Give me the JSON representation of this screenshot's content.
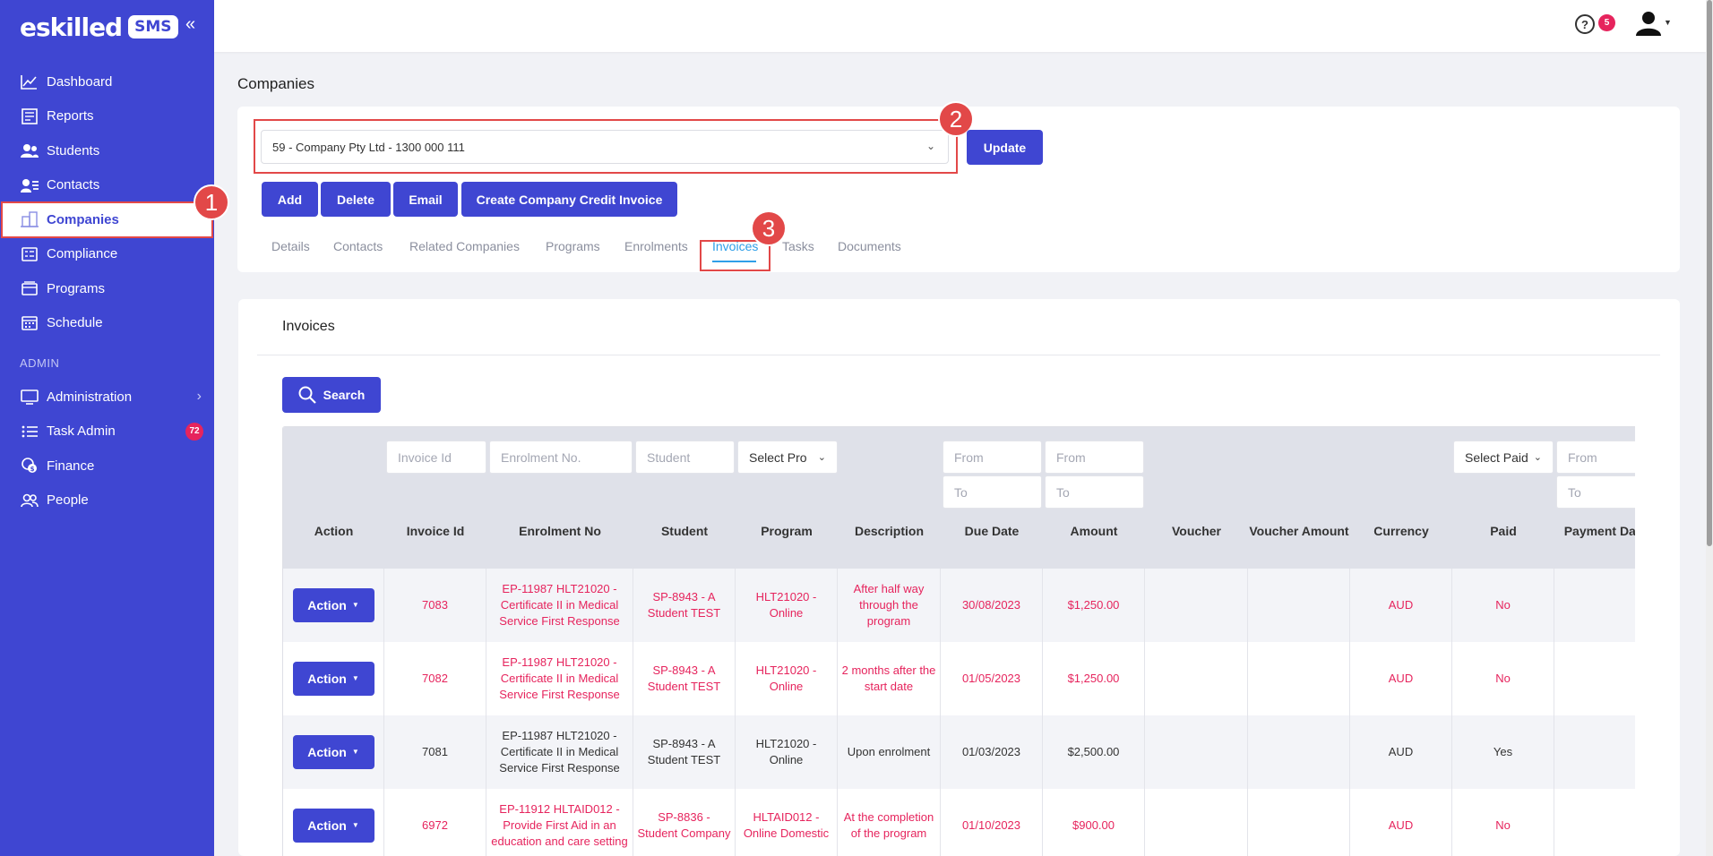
{
  "brand": {
    "logo_text": "eskilled",
    "badge": "SMS"
  },
  "sidebar": {
    "items": [
      {
        "label": "Dashboard",
        "icon": "chart-line-icon"
      },
      {
        "label": "Reports",
        "icon": "report-icon"
      },
      {
        "label": "Students",
        "icon": "students-icon"
      },
      {
        "label": "Contacts",
        "icon": "contacts-icon"
      },
      {
        "label": "Companies",
        "icon": "building-icon",
        "active": true
      },
      {
        "label": "Compliance",
        "icon": "checklist-icon"
      },
      {
        "label": "Programs",
        "icon": "programs-icon"
      },
      {
        "label": "Schedule",
        "icon": "calendar-icon"
      }
    ],
    "section_label": "ADMIN",
    "admin_items": [
      {
        "label": "Administration",
        "icon": "monitor-icon"
      },
      {
        "label": "Task Admin",
        "icon": "list-icon",
        "badge": "72"
      },
      {
        "label": "Finance",
        "icon": "coins-icon"
      },
      {
        "label": "People",
        "icon": "people-icon"
      }
    ]
  },
  "topbar": {
    "help_icon": "?",
    "notification_count": "5"
  },
  "page": {
    "title": "Companies"
  },
  "company": {
    "selected": "59 - Company Pty Ltd - 1300 000 111",
    "update_label": "Update",
    "buttons": {
      "add": "Add",
      "delete": "Delete",
      "email": "Email",
      "credit": "Create Company Credit Invoice"
    },
    "tabs": [
      "Details",
      "Contacts",
      "Related Companies",
      "Programs",
      "Enrolments",
      "Invoices",
      "Tasks",
      "Documents"
    ],
    "active_tab": "Invoices"
  },
  "callouts": [
    "1",
    "2",
    "3"
  ],
  "invoices": {
    "title": "Invoices",
    "search_label": "Search",
    "filters": {
      "invoice_id": "Invoice Id",
      "enrolment_no": "Enrolment No.",
      "student": "Student",
      "program": "Select Pro",
      "due_from": "From",
      "due_to": "To",
      "amount_from": "From",
      "amount_to": "To",
      "paid": "Select Paid",
      "payment_from": "From",
      "payment_to": "To"
    },
    "columns": [
      "Action",
      "Invoice Id",
      "Enrolment No",
      "Student",
      "Program",
      "Description",
      "Due Date",
      "Amount",
      "Voucher",
      "Voucher Amount",
      "Currency",
      "Paid",
      "Payment Date"
    ],
    "action_label": "Action",
    "rows": [
      {
        "invoice_id": "7083",
        "enrolment": "EP-11987 HLT21020 - Certificate II in Medical Service First Response",
        "student": "SP-8943 - A Student TEST",
        "program": "HLT21020 - Online",
        "description": "After half way through the program",
        "due_date": "30/08/2023",
        "amount": "$1,250.00",
        "voucher": "",
        "voucher_amount": "",
        "currency": "AUD",
        "paid": "No",
        "payment_date": "",
        "unpaid": true
      },
      {
        "invoice_id": "7082",
        "enrolment": "EP-11987 HLT21020 - Certificate II in Medical Service First Response",
        "student": "SP-8943 - A Student TEST",
        "program": "HLT21020 - Online",
        "description": "2 months after the start date",
        "due_date": "01/05/2023",
        "amount": "$1,250.00",
        "voucher": "",
        "voucher_amount": "",
        "currency": "AUD",
        "paid": "No",
        "payment_date": "",
        "unpaid": true
      },
      {
        "invoice_id": "7081",
        "enrolment": "EP-11987 HLT21020 - Certificate II in Medical Service First Response",
        "student": "SP-8943 - A Student TEST",
        "program": "HLT21020 - Online",
        "description": "Upon enrolment",
        "due_date": "01/03/2023",
        "amount": "$2,500.00",
        "voucher": "",
        "voucher_amount": "",
        "currency": "AUD",
        "paid": "Yes",
        "payment_date": "",
        "unpaid": false
      },
      {
        "invoice_id": "6972",
        "enrolment": "EP-11912 HLTAID012 - Provide First Aid in an education and care setting",
        "student": "SP-8836 - Student Company",
        "program": "HLTAID012 - Online Domestic",
        "description": "At the completion of the program",
        "due_date": "01/10/2023",
        "amount": "$900.00",
        "voucher": "",
        "voucher_amount": "",
        "currency": "AUD",
        "paid": "No",
        "payment_date": "",
        "unpaid": true
      }
    ]
  },
  "colors": {
    "primary": "#3f46d2",
    "alert": "#e6245d",
    "callout": "#e24848",
    "tab_active": "#2f9fe8"
  }
}
